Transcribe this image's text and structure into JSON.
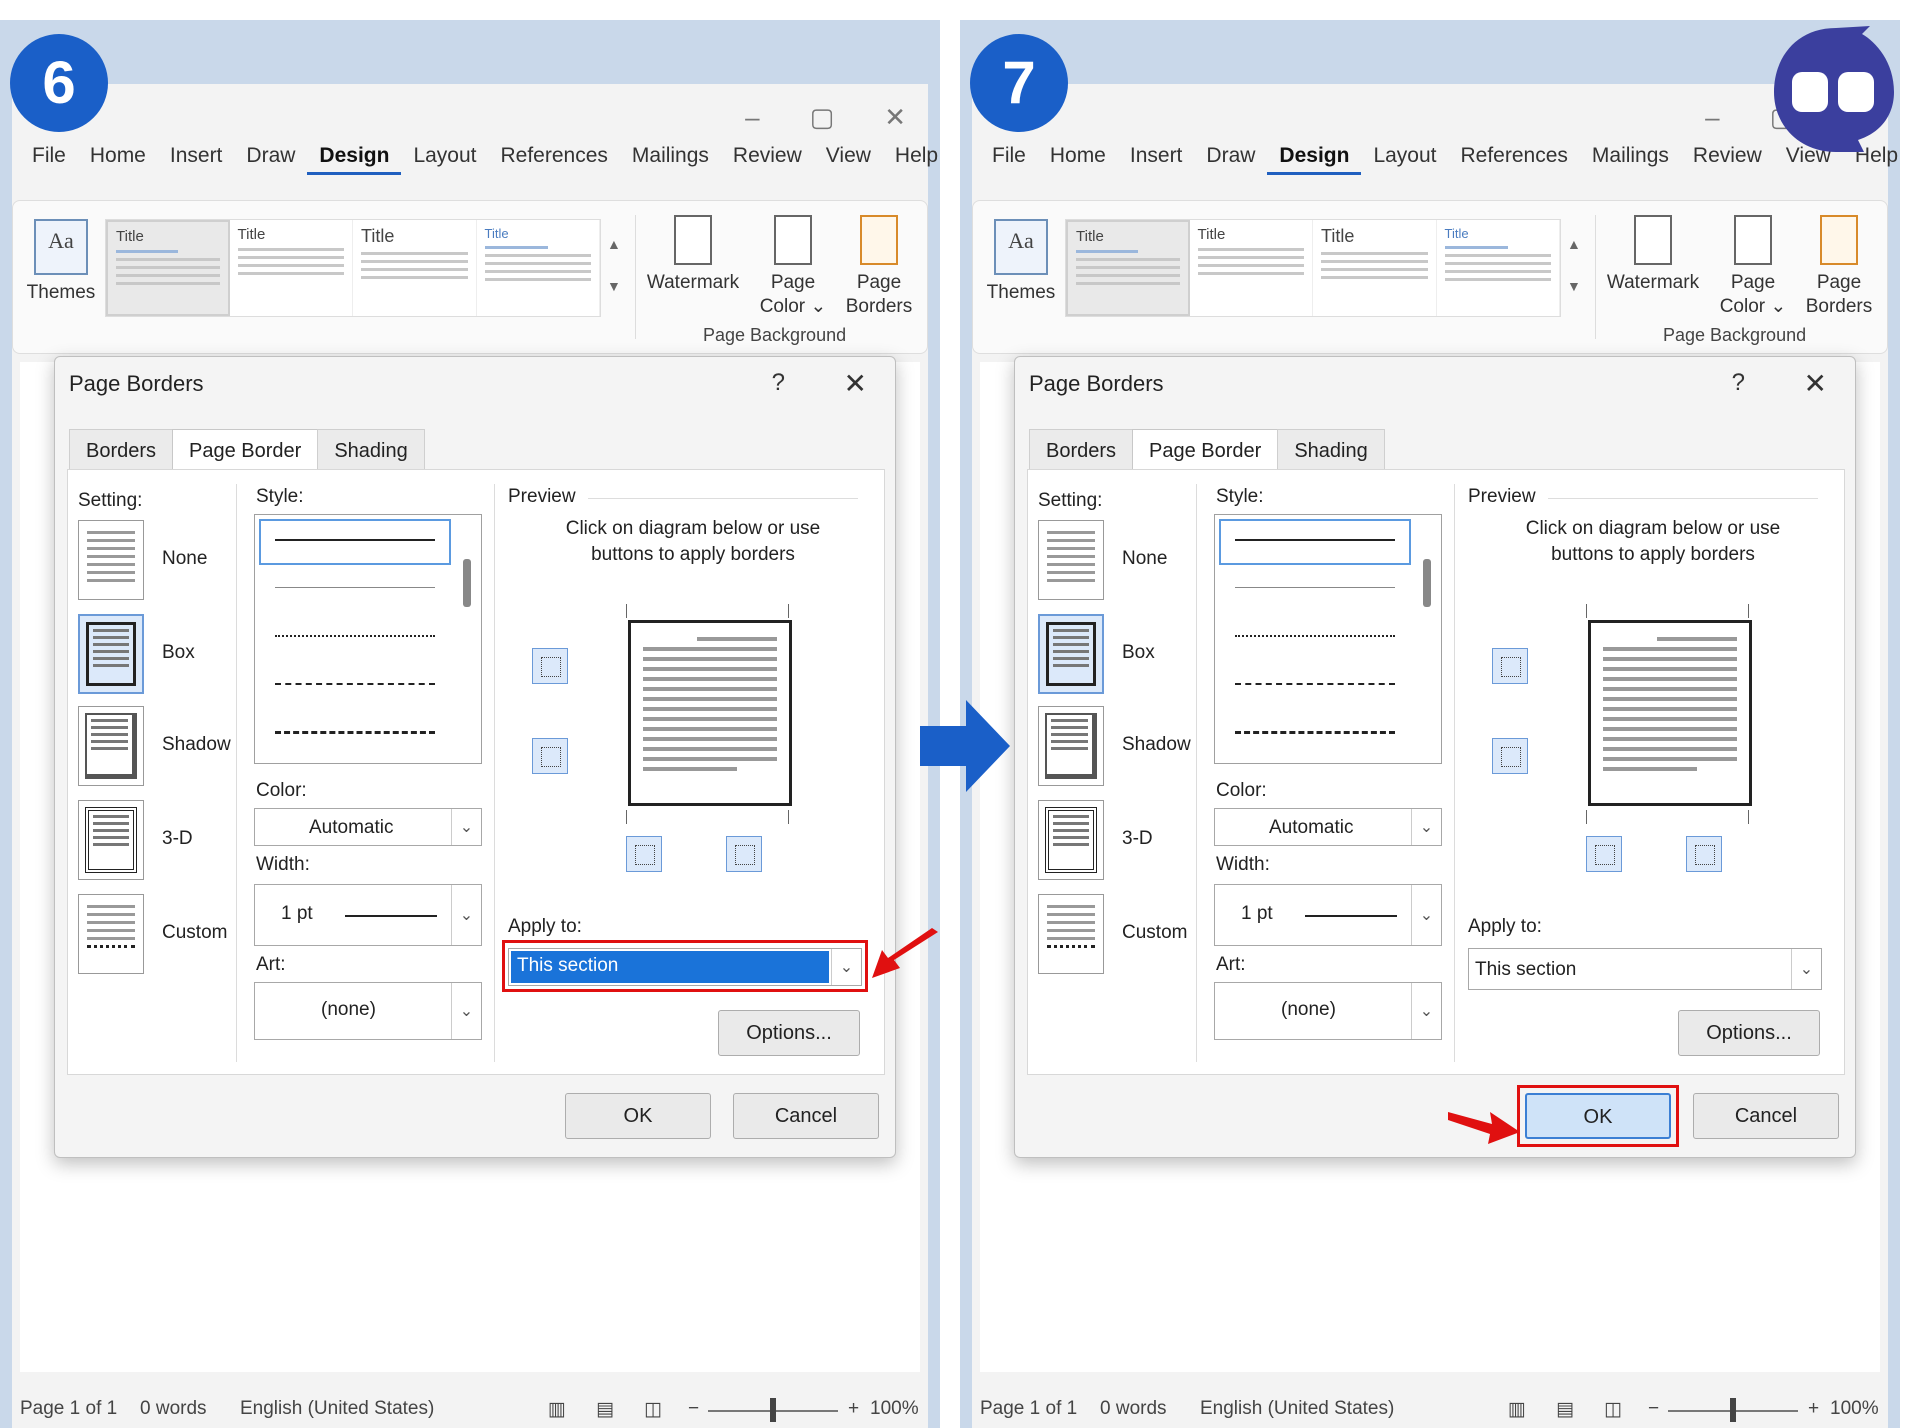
{
  "panels": [
    {
      "step": "6",
      "menu": [
        "File",
        "Home",
        "Insert",
        "Draw",
        "Design",
        "Layout",
        "References",
        "Mailings",
        "Review",
        "View",
        "Help"
      ],
      "active_menu": "Design",
      "ribbon": {
        "themes": "Themes",
        "style_title": "Title",
        "watermark": "Watermark",
        "page_color_1": "Page",
        "page_color_2": "Color ⌄",
        "page_borders_1": "Page",
        "page_borders_2": "Borders",
        "group": "Page Background"
      },
      "dialog": {
        "title": "Page Borders",
        "help": "?",
        "close": "✕",
        "tabs": [
          "Borders",
          "Page Border",
          "Shading"
        ],
        "setting_label": "Setting:",
        "settings": [
          "None",
          "Box",
          "Shadow",
          "3-D",
          "Custom"
        ],
        "style_label": "Style:",
        "color_label": "Color:",
        "color_value": "Automatic",
        "width_label": "Width:",
        "width_value": "1 pt",
        "art_label": "Art:",
        "art_value": "(none)",
        "preview_label": "Preview",
        "preview_hint_1": "Click on diagram below or use",
        "preview_hint_2": "buttons to apply borders",
        "apply_label": "Apply to:",
        "apply_value": "This section",
        "options": "Options...",
        "ok": "OK",
        "cancel": "Cancel"
      },
      "status": {
        "page": "Page 1 of 1",
        "words": "0 words",
        "lang": "English (United States)",
        "zoom": "100%"
      }
    },
    {
      "step": "7",
      "menu": [
        "File",
        "Home",
        "Insert",
        "Draw",
        "Design",
        "Layout",
        "References",
        "Mailings",
        "Review",
        "View",
        "Help"
      ],
      "active_menu": "Design",
      "ribbon": {
        "themes": "Themes",
        "style_title": "Title",
        "watermark": "Watermark",
        "page_color_1": "Page",
        "page_color_2": "Color ⌄",
        "page_borders_1": "Page",
        "page_borders_2": "Borders",
        "group": "Page Background"
      },
      "dialog": {
        "title": "Page Borders",
        "help": "?",
        "close": "✕",
        "tabs": [
          "Borders",
          "Page Border",
          "Shading"
        ],
        "setting_label": "Setting:",
        "settings": [
          "None",
          "Box",
          "Shadow",
          "3-D",
          "Custom"
        ],
        "style_label": "Style:",
        "color_label": "Color:",
        "color_value": "Automatic",
        "width_label": "Width:",
        "width_value": "1 pt",
        "art_label": "Art:",
        "art_value": "(none)",
        "preview_label": "Preview",
        "preview_hint_1": "Click on diagram below or use",
        "preview_hint_2": "buttons to apply borders",
        "apply_label": "Apply to:",
        "apply_value": "This section",
        "options": "Options...",
        "ok": "OK",
        "cancel": "Cancel"
      },
      "status": {
        "page": "Page 1 of 1",
        "words": "0 words",
        "lang": "English (United States)",
        "zoom": "100%"
      }
    }
  ],
  "colors": {
    "accent": "#1a5fc8",
    "highlight": "#e01010",
    "selection": "#1a73d9"
  }
}
